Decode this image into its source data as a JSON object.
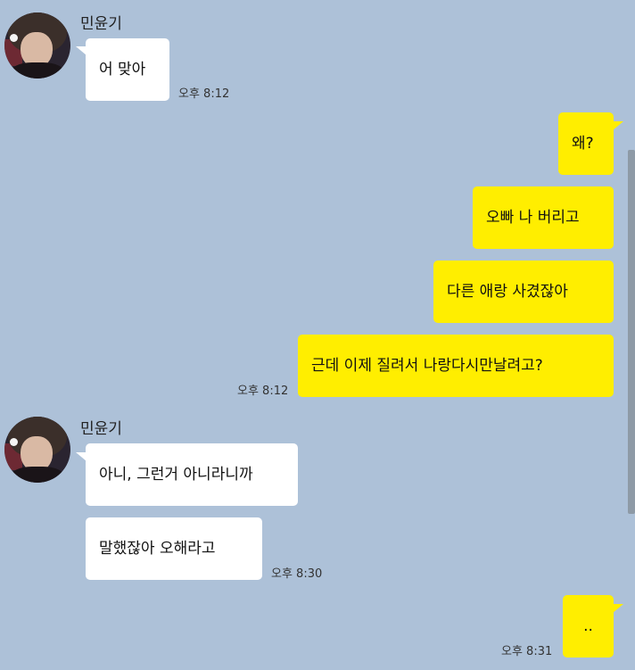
{
  "colors": {
    "background": "#adc1d8",
    "incoming_bubble": "#ffffff",
    "outgoing_bubble": "#ffee00"
  },
  "chat": {
    "group1": {
      "sender": "민윤기",
      "messages": [
        "어 맞아"
      ],
      "time": "오후 8:12"
    },
    "group2": {
      "messages": [
        "왜?",
        "오빠 나 버리고",
        "다른 애랑 사겼잖아",
        "근데 이제 질려서 나랑다시만날려고?"
      ],
      "time": "오후 8:12"
    },
    "group3": {
      "sender": "민윤기",
      "messages": [
        "아니, 그런거 아니라니까",
        "말했잖아 오해라고"
      ],
      "time": "오후 8:30"
    },
    "group4": {
      "messages": [
        ".."
      ],
      "time": "오후 8:31"
    }
  }
}
